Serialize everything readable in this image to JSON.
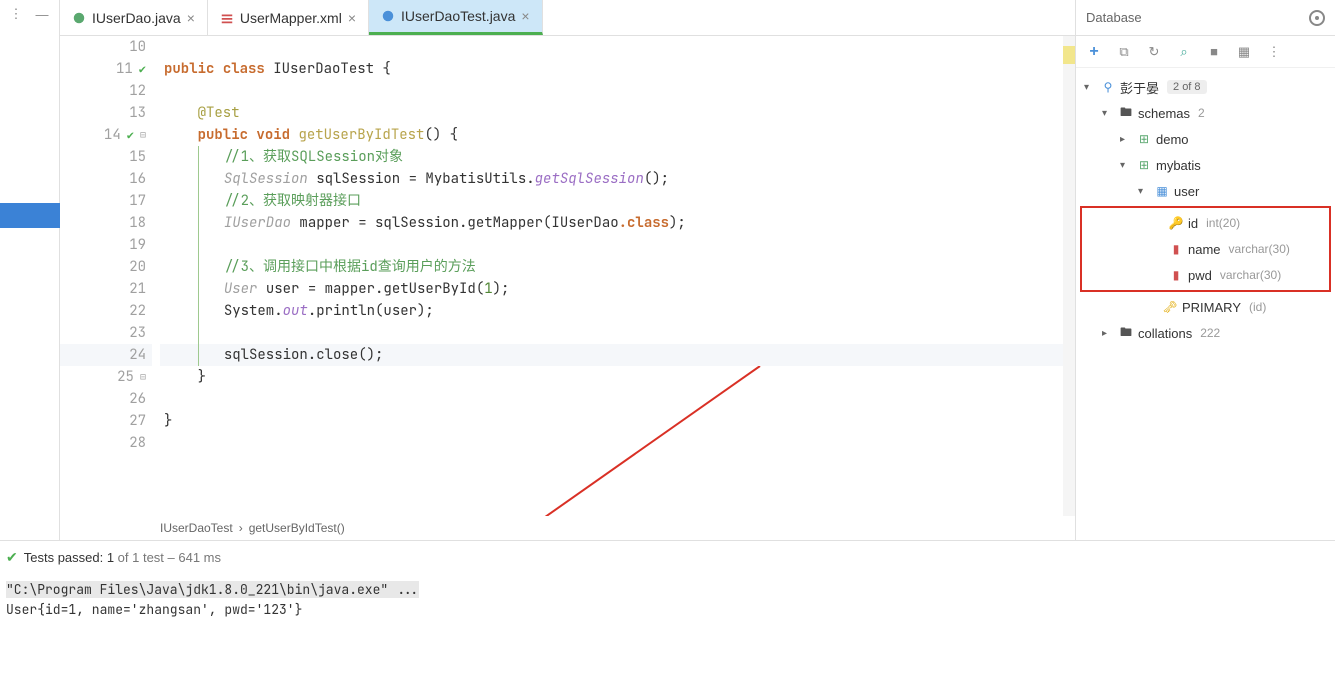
{
  "tabs": [
    {
      "name": "IUserDao.java",
      "active": false,
      "icon_color": "#5aa86f"
    },
    {
      "name": "UserMapper.xml",
      "active": false,
      "icon_color": "#d05050"
    },
    {
      "name": "IUserDaoTest.java",
      "active": true,
      "icon_color": "#4a90d9"
    }
  ],
  "gutter": {
    "start": 10,
    "end": 28,
    "current": 24,
    "run_markers": [
      11,
      14
    ]
  },
  "code": {
    "l11_kw1": "public",
    "l11_kw2": "class",
    "l11_cls": "IUserDaoTest",
    "l11_brace": " {",
    "l13_anno": "@Test",
    "l14_kw1": "public",
    "l14_kw2": "void",
    "l14_method": "getUserByIdTest",
    "l14_tail": "() {",
    "l15_comment": "//1、获取SQLSession对象",
    "l16_type": "SqlSession",
    "l16_var": " sqlSession = ",
    "l16_cls": "MybatisUtils",
    "l16_dot": ".",
    "l16_m": "getSqlSession",
    "l16_tail": "();",
    "l17_comment": "//2、获取映射器接口",
    "l18_type": "IUserDao",
    "l18_var": " mapper = sqlSession.getMapper(",
    "l18_cls": "IUserDao",
    "l18_kw": ".class",
    "l18_tail": ");",
    "l20_comment": "//3、调用接口中根据id查询用户的方法",
    "l21_type": "User",
    "l21_var": " user = mapper.getUserById(",
    "l21_num": "1",
    "l21_tail": ");",
    "l22_a": "System.",
    "l22_out": "out",
    "l22_b": ".println(user);",
    "l24_a": "sqlSession.close();",
    "l25_brace": "}",
    "l27_brace": "}"
  },
  "breadcrumb": {
    "cls": "IUserDaoTest",
    "sep": "›",
    "method": "getUserByIdTest()"
  },
  "database": {
    "title": "Database",
    "root": "彭于晏",
    "root_badge": "2 of 8",
    "schemas_label": "schemas",
    "schemas_count": "2",
    "schema1": "demo",
    "schema2": "mybatis",
    "table": "user",
    "col1_name": "id",
    "col1_type": "int(20)",
    "col2_name": "name",
    "col2_type": "varchar(30)",
    "col3_name": "pwd",
    "col3_type": "varchar(30)",
    "primary_label": "PRIMARY",
    "primary_cols": "(id)",
    "collations_label": "collations",
    "collations_count": "222"
  },
  "test": {
    "status_prefix": "Tests passed: 1",
    "status_rest": " of 1 test – 641 ms",
    "console_cmd": "\"C:\\Program Files\\Java\\jdk1.8.0_221\\bin\\java.exe\" ...",
    "console_out": "User{id=1, name='zhangsan', pwd='123'}"
  }
}
